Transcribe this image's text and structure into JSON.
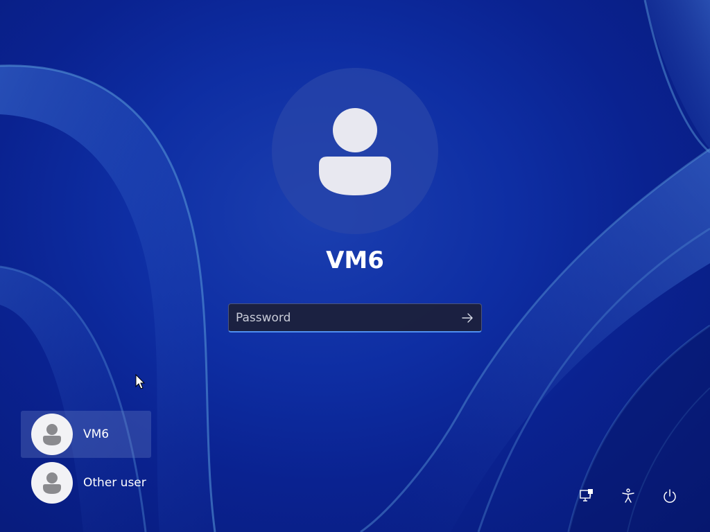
{
  "account": {
    "name": "VM6"
  },
  "password": {
    "placeholder": "Password",
    "value": ""
  },
  "users": [
    {
      "name": "VM6",
      "selected": true
    },
    {
      "name": "Other user",
      "selected": false
    }
  ],
  "system_icons": [
    "network-icon",
    "accessibility-icon",
    "power-icon"
  ],
  "colors": {
    "background": "#0e2ea3",
    "accent": "#4f8ff0",
    "avatar_circle": "#2846aa",
    "avatar_figure": "#e8e8f0"
  }
}
